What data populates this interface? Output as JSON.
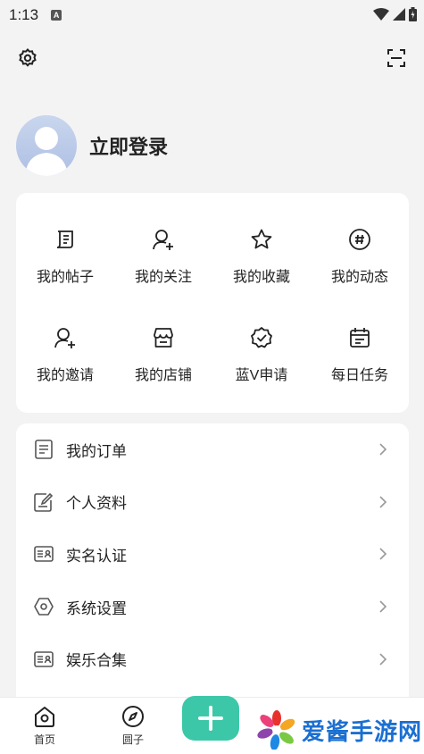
{
  "status_bar": {
    "time": "1:13",
    "notification_letter": "A"
  },
  "profile": {
    "login_label": "立即登录"
  },
  "grid": [
    {
      "label": "我的帖子",
      "icon": "posts-icon"
    },
    {
      "label": "我的关注",
      "icon": "follow-icon"
    },
    {
      "label": "我的收藏",
      "icon": "star-icon"
    },
    {
      "label": "我的动态",
      "icon": "hashtag-icon"
    },
    {
      "label": "我的邀请",
      "icon": "invite-icon"
    },
    {
      "label": "我的店铺",
      "icon": "store-icon"
    },
    {
      "label": "蓝V申请",
      "icon": "verified-badge-icon"
    },
    {
      "label": "每日任务",
      "icon": "calendar-icon"
    }
  ],
  "menu": [
    {
      "label": "我的订单",
      "icon": "order-icon"
    },
    {
      "label": "个人资料",
      "icon": "edit-profile-icon"
    },
    {
      "label": "实名认证",
      "icon": "id-card-icon"
    },
    {
      "label": "系统设置",
      "icon": "hexagon-settings-icon"
    },
    {
      "label": "娱乐合集",
      "icon": "collection-icon"
    }
  ],
  "bottom_nav": {
    "home_label": "首页",
    "circle_label": "圆子"
  },
  "watermark": {
    "text": "爱酱手游网"
  },
  "colors": {
    "accent": "#3cc8a8",
    "watermark": "#1b6fd1"
  }
}
